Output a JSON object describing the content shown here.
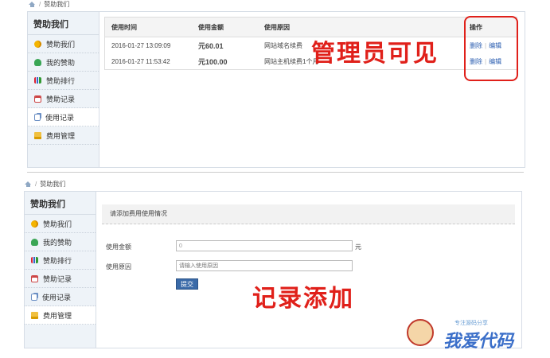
{
  "top": {
    "breadcrumb": "赞助我们",
    "sidebar_title": "赞助我们",
    "sidebar_items": [
      "赞助我们",
      "我的赞助",
      "赞助排行",
      "赞助记录",
      "使用记录",
      "费用管理"
    ],
    "table": {
      "headers": [
        "使用时间",
        "使用金额",
        "使用原因",
        "操作"
      ],
      "rows": [
        {
          "time": "2016-01-27 13:09:09",
          "amount": "元60.01",
          "reason": "网站域名续费",
          "delete": "删除",
          "edit": "编辑"
        },
        {
          "time": "2016-01-27 11:53:42",
          "amount": "元100.00",
          "reason": "网站主机续费1个月",
          "delete": "删除",
          "edit": "编辑"
        }
      ]
    },
    "annotation": "管理员可见"
  },
  "bottom": {
    "breadcrumb": "赞助我们",
    "sidebar_title": "赞助我们",
    "sidebar_items": [
      "赞助我们",
      "我的赞助",
      "赞助排行",
      "赞助记录",
      "使用记录",
      "费用管理"
    ],
    "form": {
      "heading": "请添加费用使用情况",
      "amount_label": "使用金额",
      "amount_value": "0",
      "amount_unit": "元",
      "reason_label": "使用原因",
      "reason_placeholder": "请输入使用原因",
      "submit_label": "提交"
    },
    "annotation": "记录添加"
  },
  "watermark": {
    "small": "专注源码分享",
    "large": "我爱代码"
  },
  "colors": {
    "annotation": "#e0201a",
    "amount": "#e03a1a",
    "link": "#2a5db0",
    "submit": "#3a6aa8",
    "sidebar": "#eef3f8"
  }
}
